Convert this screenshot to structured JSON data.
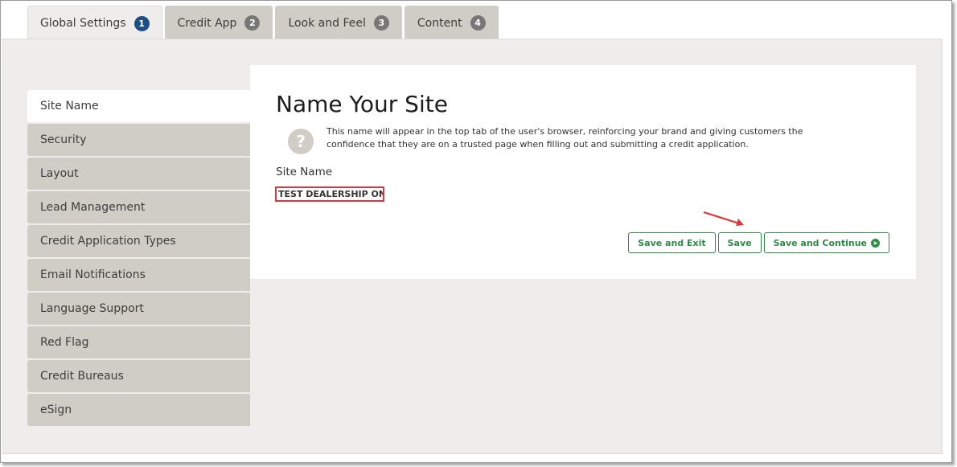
{
  "tabs": [
    {
      "label": "Global Settings",
      "badge": "1",
      "active": true
    },
    {
      "label": "Credit App",
      "badge": "2",
      "active": false
    },
    {
      "label": "Look and Feel",
      "badge": "3",
      "active": false
    },
    {
      "label": "Content",
      "badge": "4",
      "active": false
    }
  ],
  "sidebar": {
    "items": [
      {
        "label": "Site Name"
      },
      {
        "label": "Security"
      },
      {
        "label": "Layout"
      },
      {
        "label": "Lead Management"
      },
      {
        "label": "Credit Application Types"
      },
      {
        "label": "Email Notifications"
      },
      {
        "label": "Language Support"
      },
      {
        "label": "Red Flag"
      },
      {
        "label": "Credit Bureaus"
      },
      {
        "label": "eSign"
      }
    ]
  },
  "main": {
    "title": "Name Your Site",
    "help_icon": "question-circle-icon",
    "help_text": "This name will appear in the top tab of the user's browser, reinforcing your brand and giving customers the confidence that they are on a trusted page when filling out and submitting a credit application.",
    "field_label": "Site Name",
    "field_value": "TEST DEALERSHIP ONLY W",
    "buttons": {
      "save_exit": "Save and Exit",
      "save": "Save",
      "save_continue": "Save and Continue"
    }
  },
  "colors": {
    "accent_green": "#2e8b45",
    "active_badge": "#1d4f86",
    "highlight_red": "#d9363e"
  }
}
